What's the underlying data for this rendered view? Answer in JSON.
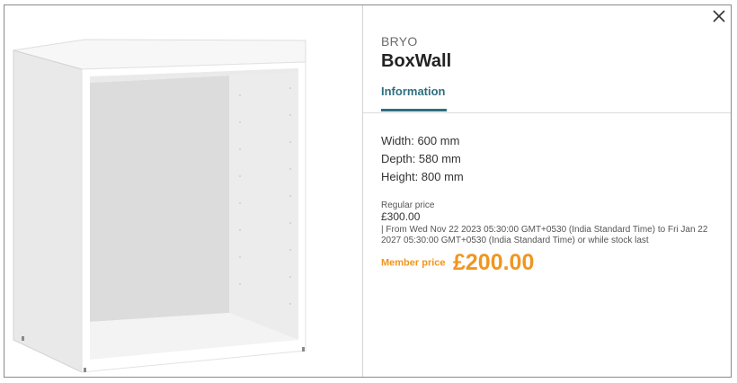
{
  "product": {
    "brand": "BRYO",
    "name": "BoxWall",
    "image_alt": "white cabinet frame"
  },
  "tabs": [
    {
      "label": "Information",
      "active": true
    }
  ],
  "specs": [
    "Width: 600 mm",
    "Depth: 580 mm",
    "Height: 800 mm"
  ],
  "pricing": {
    "regular_label": "Regular price",
    "regular_price": "£300.00",
    "validity": "| From Wed Nov 22 2023 05:30:00 GMT+0530 (India Standard Time) to Fri Jan 22 2027 05:30:00 GMT+0530 (India Standard Time) or while stock last",
    "member_label": "Member price",
    "member_price": "£200.00"
  },
  "colors": {
    "accent": "#2f6f7f",
    "member": "#f0961f"
  },
  "icons": {
    "close": "close-icon"
  }
}
